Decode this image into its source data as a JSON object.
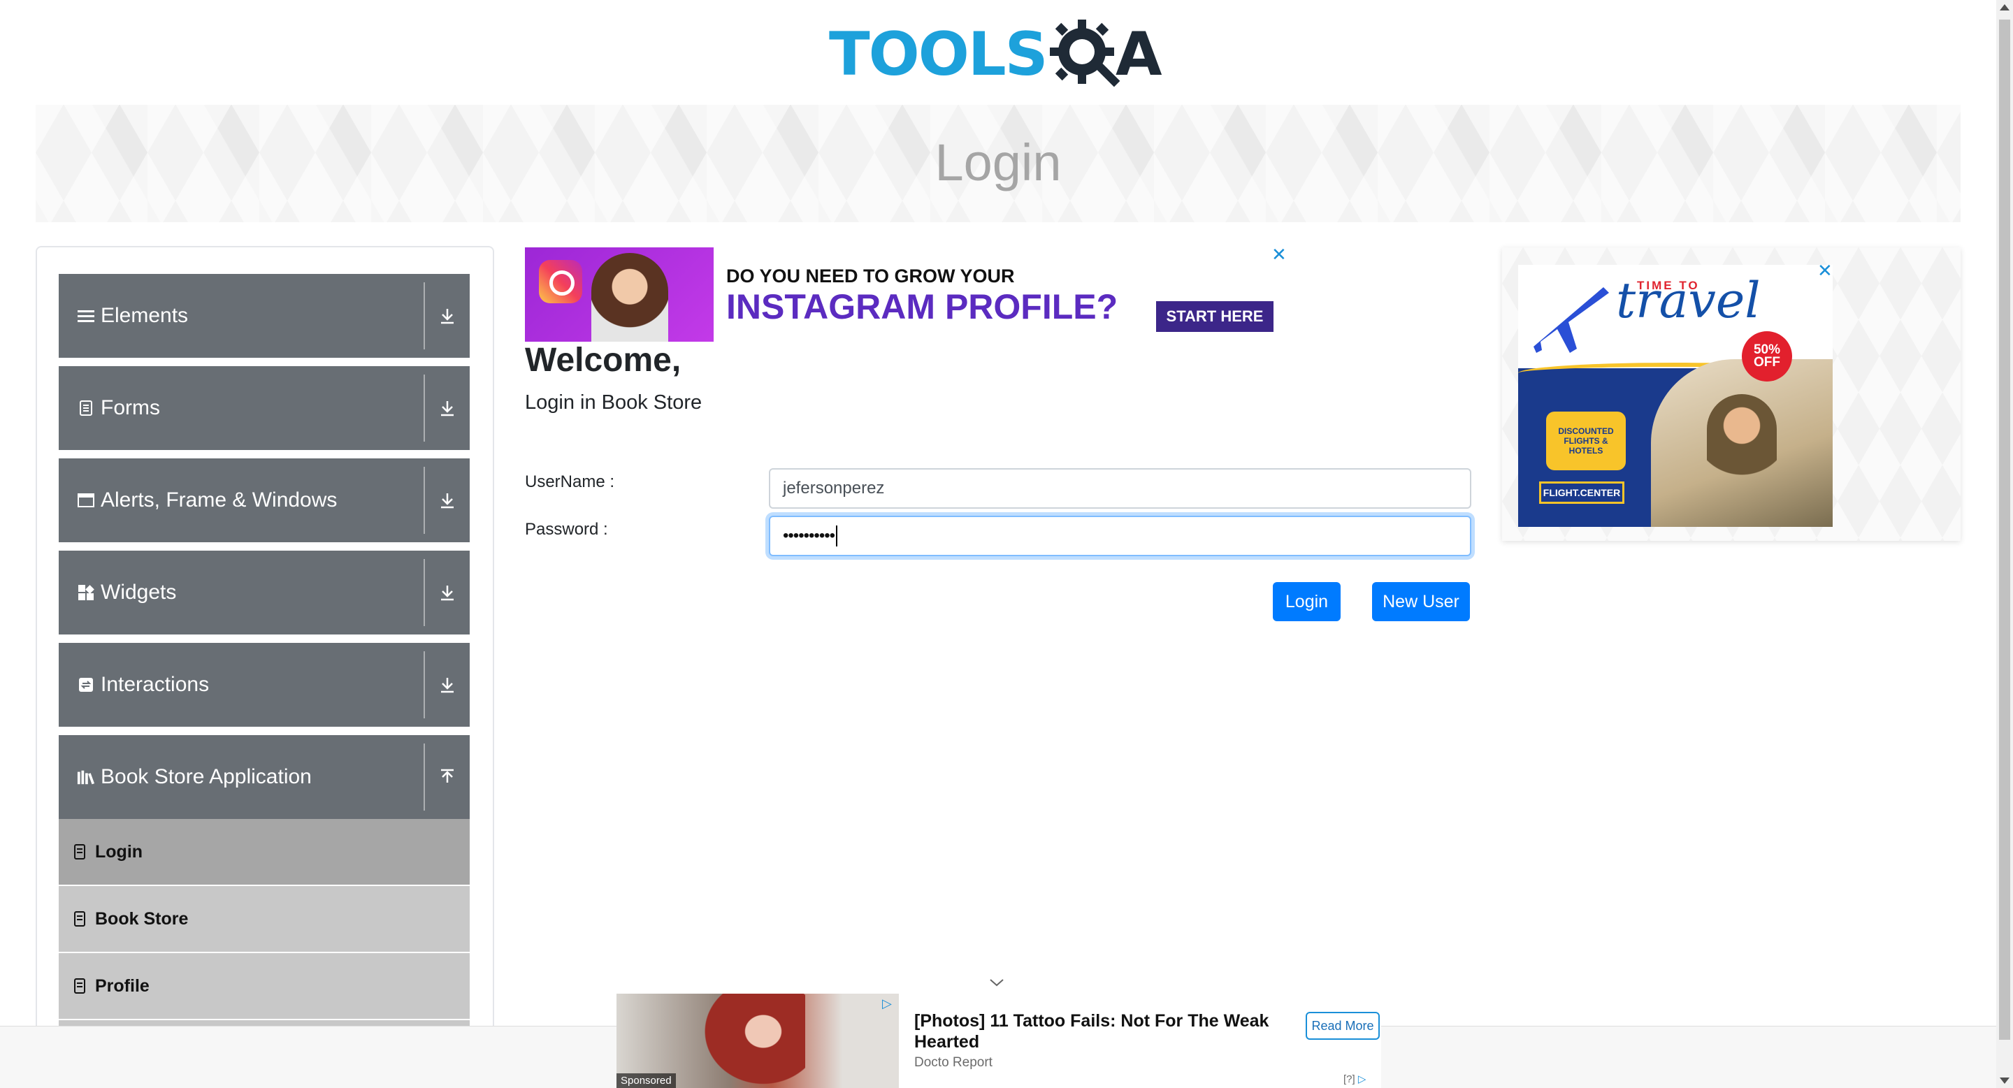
{
  "logo": {
    "text_main": "TOOLS",
    "text_end": "A",
    "icon": "gear-magnifier-icon",
    "colors": {
      "blue": "#1da1db",
      "dark": "#1f2a36"
    }
  },
  "banner": {
    "title": "Login"
  },
  "sidebar": {
    "groups": [
      {
        "label": "Elements",
        "icon": "hamburger-icon",
        "arrow": "download-icon"
      },
      {
        "label": "Forms",
        "icon": "document-icon",
        "arrow": "download-icon"
      },
      {
        "label": "Alerts, Frame & Windows",
        "icon": "window-icon",
        "arrow": "download-icon"
      },
      {
        "label": "Widgets",
        "icon": "widgets-icon",
        "arrow": "download-icon"
      },
      {
        "label": "Interactions",
        "icon": "interactions-icon",
        "arrow": "download-icon"
      },
      {
        "label": "Book Store Application",
        "icon": "books-icon",
        "arrow": "upload-icon"
      }
    ],
    "book_store_items": [
      {
        "label": "Login",
        "active": true
      },
      {
        "label": "Book Store",
        "active": false
      },
      {
        "label": "Profile",
        "active": false
      }
    ],
    "colors": {
      "group_bg": "#686e74",
      "sub_bg": "#c8c8c8",
      "sub_active_bg": "#a6a6a6"
    }
  },
  "ad_top": {
    "line1": "DO YOU NEED TO GROW YOUR",
    "line2": "INSTAGRAM PROFILE?",
    "cta": "START HERE",
    "close": "✕"
  },
  "form": {
    "welcome": "Welcome,",
    "subtitle": "Login in Book Store",
    "username_label": "UserName :",
    "username_value": "jefersonperez",
    "password_label": "Password :",
    "password_value": "••••••••••",
    "login_button": "Login",
    "new_user_button": "New User",
    "accent": "#007bff"
  },
  "ad_right": {
    "small": "TIME TO",
    "title": "travel",
    "sale": "50% OFF",
    "discount": "DISCOUNTED FLIGHTS & HOTELS",
    "brand": "FLIGHT.CENTER",
    "close": "✕"
  },
  "sponsored": {
    "tag": "Sponsored",
    "title": "[Photos] 11 Tattoo Fails: Not For The Weak Hearted",
    "source": "Docto Report",
    "read_more": "Read More",
    "question": "[?]"
  }
}
